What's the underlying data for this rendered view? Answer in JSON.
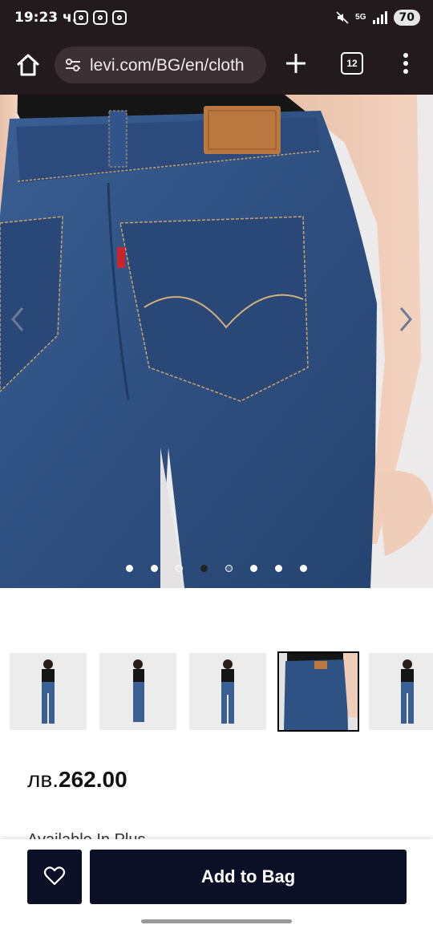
{
  "status": {
    "time": "19:23 ч.",
    "network": "5G",
    "battery": "70"
  },
  "browser": {
    "url": "levi.com/BG/en/cloth",
    "tab_count": "12"
  },
  "product": {
    "image_dots_count": 8,
    "image_active_index": 3,
    "thumbnails_selected_index": 3,
    "price_currency": "лв.",
    "price_value": "262.00",
    "available_note": "Available In Plus"
  },
  "actions": {
    "add_to_bag_label": "Add to Bag"
  },
  "colors": {
    "chrome_bg": "#231a1e",
    "button_bg": "#0b1027",
    "denim": "#2f5285"
  },
  "icons": {
    "home": "home-icon",
    "tune": "site-settings-icon",
    "new_tab": "plus-icon",
    "menu": "more-vert-icon",
    "wishlist": "heart-icon",
    "prev": "chevron-left-icon",
    "next": "chevron-right-icon"
  }
}
